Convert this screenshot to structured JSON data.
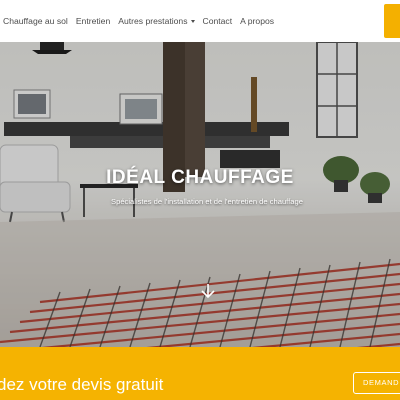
{
  "nav": {
    "items": [
      {
        "label": "Chauffage au sol"
      },
      {
        "label": "Entretien"
      },
      {
        "label": "Autres prestations",
        "has_dropdown": true
      },
      {
        "label": "Contact"
      },
      {
        "label": "A propos"
      }
    ],
    "cta_color": "#f4b000"
  },
  "hero": {
    "title": "IDÉAL CHAUFFAGE",
    "subtitle": "Spécialistes de l'installation et de l'entretien de chauffage",
    "scroll_icon": "chevron-down-icon"
  },
  "cta": {
    "text": "dez votre devis gratuit",
    "button_label": "DEMAND",
    "background": "#f5b301"
  }
}
